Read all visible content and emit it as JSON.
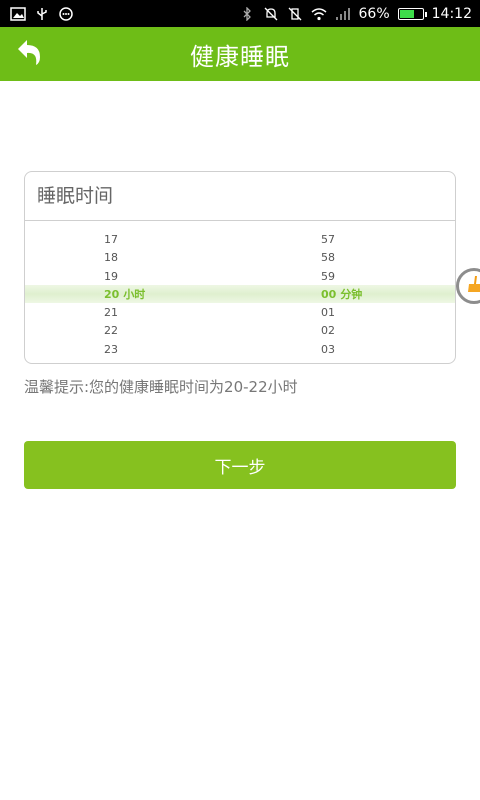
{
  "status_bar": {
    "left_icons": [
      "image-icon",
      "usb-icon",
      "chat-icon"
    ],
    "right_icons": [
      "bluetooth-icon",
      "mute-icon",
      "vibrate-off-icon",
      "wifi-icon",
      "signal-icon"
    ],
    "battery_percent": "66%",
    "battery_level": 0.66,
    "time": "14:12"
  },
  "header": {
    "back_icon": "back-arrow-icon",
    "title": "健康睡眠"
  },
  "card": {
    "title": "睡眠时间",
    "hours": {
      "items": [
        "17",
        "18",
        "19",
        "20",
        "21",
        "22",
        "23"
      ],
      "selected": "20",
      "unit": "小时"
    },
    "minutes": {
      "items": [
        "57",
        "58",
        "59",
        "00",
        "01",
        "02",
        "03"
      ],
      "selected": "00",
      "unit": "分钟"
    }
  },
  "hint": "温馨提示:您的健康睡眠时间为20-22小时",
  "next_button": "下一步",
  "colors": {
    "header_bg": "#6ebd17",
    "button_bg": "#86c11f",
    "selected_text": "#7bbf2e"
  }
}
